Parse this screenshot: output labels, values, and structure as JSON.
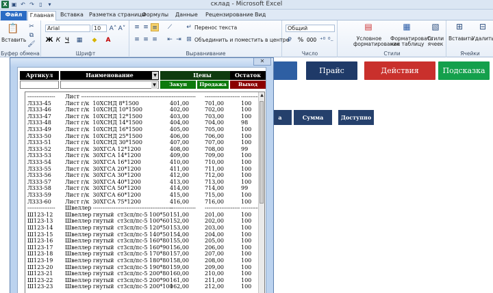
{
  "app": {
    "title": "склад - Microsoft Excel",
    "tabs": [
      "Файл",
      "Главная",
      "Вставка",
      "Разметка страницы",
      "Формулы",
      "Данные",
      "Рецензирование",
      "Вид"
    ]
  },
  "ribbon": {
    "paste_label": "Вставить",
    "clipboard_label": "Буфер обмена",
    "font_name": "Arial",
    "font_size": "10",
    "font_label": "Шрифт",
    "wrap_label": "Перенос текста",
    "merge_label": "Объединить и поместить в центре",
    "align_label": "Выравнивание",
    "number_format": "Общий",
    "number_label": "Число",
    "cond_format_label": "Условное форматирование",
    "format_table_label": "Форматировать как таблицу",
    "cell_styles_label": "Стили ячеек",
    "styles_label": "Стили",
    "insert_label": "Вставить",
    "delete_label": "Удалить",
    "cells_label": "Ячейки",
    "bold": "Ж",
    "italic": "К",
    "underline": "Ч",
    "percent": "%",
    "thousands": "000"
  },
  "sheet_buttons": [
    {
      "label": "ые",
      "color": "#2e5fa3"
    },
    {
      "label": "Прайс",
      "color": "#1f3a68"
    },
    {
      "label": "Действия",
      "color": "#c9302c"
    },
    {
      "label": "Подсказка",
      "color": "#14a04c"
    }
  ],
  "sheet_headers": [
    "а",
    "Сумма",
    "Доступно"
  ],
  "dialog": {
    "close": "✕",
    "headers": {
      "article": "Артикул",
      "name": "Наименование",
      "prices": "Цены",
      "stock": "Остаток",
      "buy": "Закуп",
      "sell": "Продажа",
      "out": "Выход"
    },
    "colors": {
      "buy": "#0c7a0c",
      "sell": "#0c7a0c",
      "out": "#8b0000"
    },
    "rows": [
      [
        "---------------",
        "Лист ------------------------------------------------",
        "--------------",
        "-------------------",
        "-------------"
      ],
      [
        "Л333-45",
        "Лист г/к  10ХСНД 8*1500",
        "401,00",
        "701,00",
        "100"
      ],
      [
        "Л333-46",
        "Лист г/к  10ХСНД 10*1500",
        "402,00",
        "702,00",
        "100"
      ],
      [
        "Л333-47",
        "Лист г/к  10ХСНД 12*1500",
        "403,00",
        "703,00",
        "100"
      ],
      [
        "Л333-48",
        "Лист г/к  10ХСНД 14*1500",
        "404,00",
        "704,00",
        "98"
      ],
      [
        "Л333-49",
        "Лист г/к  10ХСНД 16*1500",
        "405,00",
        "705,00",
        "100"
      ],
      [
        "Л333-50",
        "Лист г/к  10ХСНД 25*1500",
        "406,00",
        "706,00",
        "100"
      ],
      [
        "Л333-51",
        "Лист г/к  10ХСНД 30*1500",
        "407,00",
        "707,00",
        "100"
      ],
      [
        "Л333-52",
        "Лист г/к  30ХГСА 12*1200",
        "408,00",
        "708,00",
        "99"
      ],
      [
        "Л333-53",
        "Лист г/к  30ХГСА 14*1200",
        "409,00",
        "709,00",
        "100"
      ],
      [
        "Л333-54",
        "Лист г/к  30ХГСА 16*1200",
        "410,00",
        "710,00",
        "100"
      ],
      [
        "Л333-55",
        "Лист г/к  30ХГСА 20*1200",
        "411,00",
        "711,00",
        "100"
      ],
      [
        "Л333-56",
        "Лист г/к  30ХГСА 30*1200",
        "412,00",
        "712,00",
        "100"
      ],
      [
        "Л333-57",
        "Лист г/к  30ХГСА 40*1200",
        "413,00",
        "713,00",
        "100"
      ],
      [
        "Л333-58",
        "Лист г/к  30ХГСА 50*1200",
        "414,00",
        "714,00",
        "99"
      ],
      [
        "Л333-59",
        "Лист г/к  30ХГСА 60*1200",
        "415,00",
        "715,00",
        "100"
      ],
      [
        "Л333-60",
        "Лист г/к  30ХГСА 75*1200",
        "416,00",
        "716,00",
        "100"
      ],
      [
        "---------------",
        "Швеллер -------------------------------------------",
        "--------------",
        "-------------------",
        "-------------"
      ],
      [
        "Ш123-12",
        "Швеллер гнутый  ст3сп/пс-5 100*50",
        "151,00",
        "201,00",
        "100"
      ],
      [
        "Ш123-13",
        "Швеллер гнутый  ст3сп/пс-5 100*60",
        "152,00",
        "202,00",
        "100"
      ],
      [
        "Ш123-14",
        "Швеллер гнутый  ст3сп/пс-5 120*50",
        "153,00",
        "203,00",
        "100"
      ],
      [
        "Ш123-15",
        "Швеллер гнутый  ст3сп/пс-5 140*50",
        "154,00",
        "204,00",
        "100"
      ],
      [
        "Ш123-16",
        "Швеллер гнутый  ст3сп/пс-5 160*80",
        "155,00",
        "205,00",
        "100"
      ],
      [
        "Ш123-17",
        "Швеллер гнутый  ст3сп/пс-5 160*90",
        "156,00",
        "206,00",
        "100"
      ],
      [
        "Ш123-18",
        "Швеллер гнутый  ст3сп/пс-5 170*80",
        "157,00",
        "207,00",
        "100"
      ],
      [
        "Ш123-19",
        "Швеллер гнутый  ст3сп/пс-5 180*80",
        "158,00",
        "208,00",
        "100"
      ],
      [
        "Ш123-20",
        "Швеллер гнутый  ст3сп/пс-5 190*80",
        "159,00",
        "209,00",
        "100"
      ],
      [
        "Ш123-21",
        "Швеллер гнутый  ст3сп/пс-5 200*80",
        "160,00",
        "210,00",
        "100"
      ],
      [
        "Ш123-22",
        "Швеллер гнутый  ст3сп/пс-5 200*90",
        "161,00",
        "211,00",
        "100"
      ],
      [
        "Ш123-23",
        "Швеллер гнутый  ст3сп/пс-5 200*100",
        "162,00",
        "212,00",
        "100"
      ]
    ]
  }
}
